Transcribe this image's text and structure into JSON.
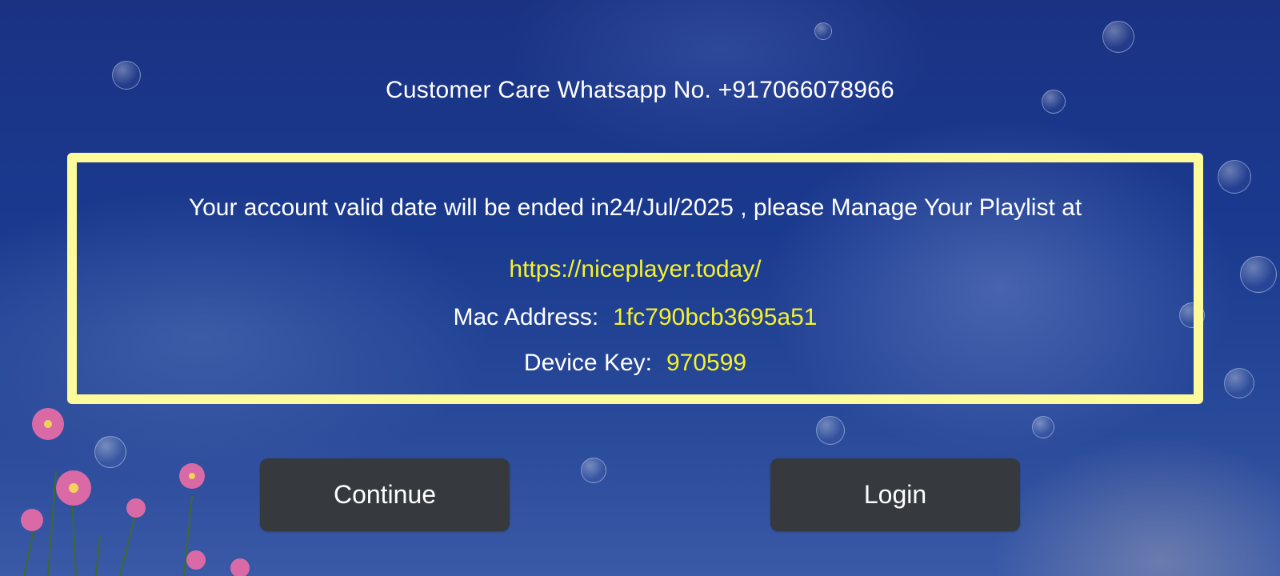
{
  "header": {
    "customer_care": "Customer Care Whatsapp No. +917066078966"
  },
  "notice": {
    "message": "Your account valid date will be ended in24/Jul/2025 , please Manage Your Playlist at",
    "url": "https://niceplayer.today/",
    "mac_label": "Mac Address:",
    "mac_value": "1fc790bcb3695a51",
    "key_label": "Device Key:",
    "key_value": "970599",
    "border_color": "#fdfa9c",
    "highlight_color": "#f5f22a"
  },
  "actions": {
    "continue_label": "Continue",
    "login_label": "Login"
  }
}
